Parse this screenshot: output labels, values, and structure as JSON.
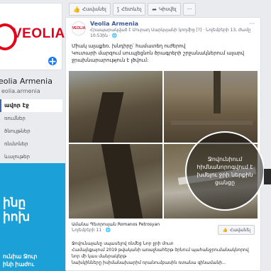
{
  "page": {
    "logo_text": "VEOLIA",
    "name": "eolia Armenia",
    "handle": "eolia.armenia",
    "nav": [
      {
        "label": "ավոր էջ",
        "active": true
      },
      {
        "label": "ռումներ",
        "active": false
      },
      {
        "label": "ծնույթներ",
        "active": false
      },
      {
        "label": "ռնմտներ",
        "active": false
      },
      {
        "label": "ևալութեր",
        "active": false
      }
    ]
  },
  "promo": {
    "title_line1": "ինը",
    "title_line2": "իոխ",
    "sub_line1": "ունիա Ջուր",
    "sub_line2": "ինի իաժու"
  },
  "action_bar": {
    "like_label": "Հավանել",
    "follow_label": "Հետևել",
    "share_label": "Կիսվել",
    "more_label": "···"
  },
  "post": {
    "author": "Veolia Armenia",
    "meta": "Հրապարակված է Մուրադ Սարկսյանի կողմից [?] · Նոյեմբերի 13, ժամը 10:53ին · ",
    "more": "···",
    "text_line1": "Միակ ալաքեռ. խնդիրը՝ համատեղ ուժերով",
    "text_line2": "Կուտարի մարզում սուպլեցնոն ծրագրերի շրջանակներում ալարվ ջրախնարարություն է լծվում:",
    "overlay_text": "Ջովունիում հիմնանորոգվում է խմելու ջրի ներքին ցանցը",
    "shared_name": "Ամանա Պետրոսյան Romanos Petrosyan",
    "shared_date": "Նոյեմբերի 11 · ",
    "like_page_label": "Հավանել",
    "shared_line1": "Ջովունայանը սպասելով ռնմեց Նոր ջրի մուտ",
    "shared_line2": "Համայնքայում 2019 թվականի առաջնահերթ ծրնում պահանջրումանակնորով նոր մի կաս մանրակերթ",
    "shared_line3": "նախկինները իսիմանախարիմ ռրանումբասին ռտանա գինամանի..."
  },
  "colors": {
    "brand_red": "#e2001a",
    "fb_blue": "#385898",
    "promo_blue": "#1ba0d7"
  }
}
